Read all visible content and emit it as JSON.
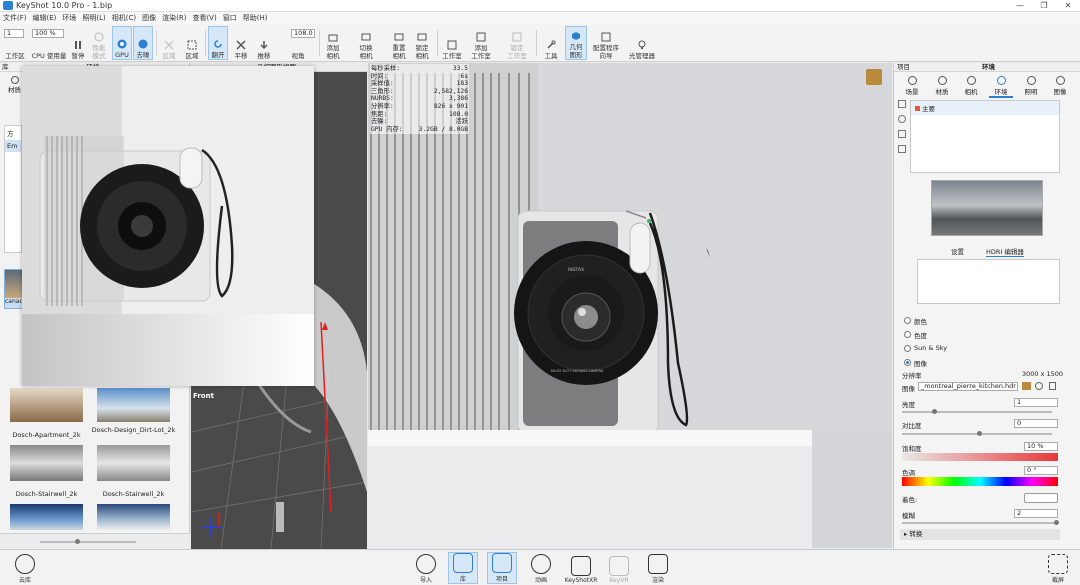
{
  "window": {
    "title": "KeyShot 10.0 Pro  - 1.bip",
    "controls": [
      "—",
      "❐",
      "✕"
    ]
  },
  "menu": [
    "文件(F)",
    "编辑(E)",
    "环境",
    "照明(L)",
    "相机(C)",
    "图像",
    "渲染(R)",
    "查看(V)",
    "窗口",
    "帮助(H)"
  ],
  "toolbar": {
    "workspace_select": "1",
    "zoom_select": "100 %",
    "fov_value": "108.0",
    "buttons": {
      "workspace": "工作区",
      "cpu_usage": "CPU 使用量",
      "pause": "暂停",
      "perf_mode_1": "性能",
      "perf_mode_2": "模式",
      "gpu": "GPU",
      "denoise": "去噪",
      "region_1": "区域",
      "region_2": "区域",
      "flip": "翻开",
      "pan": "平移",
      "push": "推移",
      "fov": "视角",
      "add_camera_1": "添加",
      "add_camera_2": "相机",
      "switch_camera_1": "切换",
      "switch_camera_2": "相机",
      "reset_camera_1": "重置",
      "reset_camera_2": "相机",
      "lock_camera_1": "锁定",
      "lock_camera_2": "相机",
      "studio": "工作室",
      "add_studio_1": "添加",
      "add_studio_2": "工作室",
      "lock_studio_1": "锁定",
      "lock_studio_2": "工作室",
      "tools": "工具",
      "geometry_view_1": "几何",
      "geometry_view_2": "图形",
      "config_wizard_1": "配置程序",
      "config_wizard_2": "向导",
      "light_manager": "光管理器"
    }
  },
  "library": {
    "header_left": "库",
    "header_mid": "环境",
    "tab_materials": "材质",
    "tree_items": [
      "方",
      "Em"
    ],
    "search_label": "canac",
    "thumbnails": [
      {
        "label": "Dosch-Apartment_2k"
      },
      {
        "label": "Dosch-Design_Dirt-Lot_2k"
      },
      {
        "label": "Dosch-Stairwell_2k"
      },
      {
        "label": "Dosch-Stairwell_2k"
      }
    ]
  },
  "geometry_view": {
    "header": "几何图形视图",
    "label": "Front"
  },
  "viewport": {
    "stats": [
      {
        "k": "每秒采样:",
        "v": "33.5"
      },
      {
        "k": "时间:",
        "v": "6s"
      },
      {
        "k": "采样值:",
        "v": "183"
      },
      {
        "k": "三角形:",
        "v": "2,582,126"
      },
      {
        "k": "NURBS:",
        "v": "3,386"
      },
      {
        "k": "分辨率:",
        "v": "826 x 901"
      },
      {
        "k": "焦距:",
        "v": "108.0"
      },
      {
        "k": "去噪:",
        "v": "活跃"
      },
      {
        "k": "GPU 内存:",
        "v": "3.2GB / 8.0GB"
      }
    ],
    "camera_text_1": "INSTAX",
    "camera_text_2": "MULTI SLOT INSTANT CAMERA"
  },
  "project": {
    "header_left": "项目",
    "header_title": "环境",
    "tabs": [
      "场景",
      "材质",
      "相机",
      "环境",
      "照明",
      "图像"
    ],
    "env_list": [
      "主要"
    ],
    "subtabs": [
      "设置",
      "HDRI 编辑器"
    ],
    "lighting_options": [
      "颜色",
      "色度",
      "Sun & Sky",
      "图像"
    ],
    "resolution_label": "分辨率",
    "resolution_value": "3000 x 1500",
    "image_label": "图像",
    "image_value": "_montreal_pierre_kitchen.hdr",
    "brightness_label": "亮度",
    "brightness_value": "1",
    "contrast_label": "对比度",
    "contrast_value": "0",
    "saturation_label": "饱和度",
    "saturation_value": "10 %",
    "hue_label": "色调",
    "hue_value": "0 °",
    "tint_label": "着色:",
    "blur_label": "模糊",
    "blur_value": "2",
    "transform_label": "▸ 转换"
  },
  "bottom": {
    "cloud_library": "云库",
    "import": "导入",
    "library": "库",
    "project": "项目",
    "animation": "动画",
    "keyshotxr": "KeyShotXR",
    "keyvr": "KeyVR",
    "render": "渲染",
    "screenshot": "截屏"
  },
  "colors": {
    "accent": "#2d7fd2",
    "viewport_bg": "#d9dade",
    "selection": "#d6e8f7"
  }
}
